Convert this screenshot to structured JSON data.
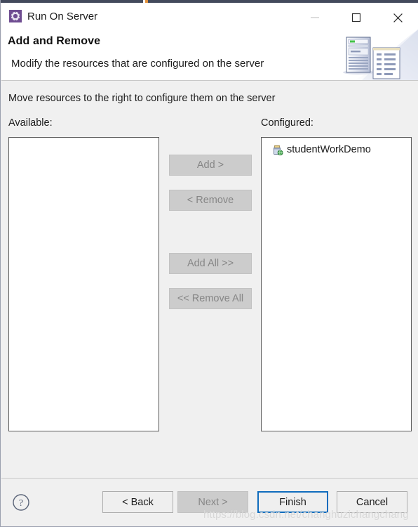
{
  "window": {
    "title": "Run On Server",
    "app_icon": "gear-icon",
    "controls": {
      "minimize": "minimize-icon",
      "maximize": "maximize-icon",
      "close": "close-icon"
    }
  },
  "header": {
    "title": "Add and Remove",
    "description": "Modify the resources that are configured on the server",
    "banner_icon": "server-and-document-icon"
  },
  "main": {
    "instruction": "Move resources to the right to configure them on the server",
    "available": {
      "label": "Available:",
      "items": []
    },
    "configured": {
      "label": "Configured:",
      "items": [
        {
          "name": "studentWorkDemo",
          "icon": "web-project-icon"
        }
      ]
    },
    "transfer_buttons": [
      {
        "label": "Add >",
        "enabled": false
      },
      {
        "label": "< Remove",
        "enabled": false
      },
      {
        "label": "Add All >>",
        "enabled": false
      },
      {
        "label": "<< Remove All",
        "enabled": false
      }
    ]
  },
  "footer": {
    "help_icon": "help-question-icon",
    "buttons": {
      "back": "< Back",
      "next": "Next >",
      "finish": "Finish",
      "cancel": "Cancel"
    }
  },
  "watermark": "https://blog.csdn.net/changhuzichangchang",
  "colors": {
    "accent": "#0f6cbd",
    "dialog_bg": "#f0f0f0",
    "header_bg": "#ffffff",
    "disabled_bg": "#cccccc",
    "disabled_text": "#868686",
    "icon_purple": "#6f4d91"
  }
}
